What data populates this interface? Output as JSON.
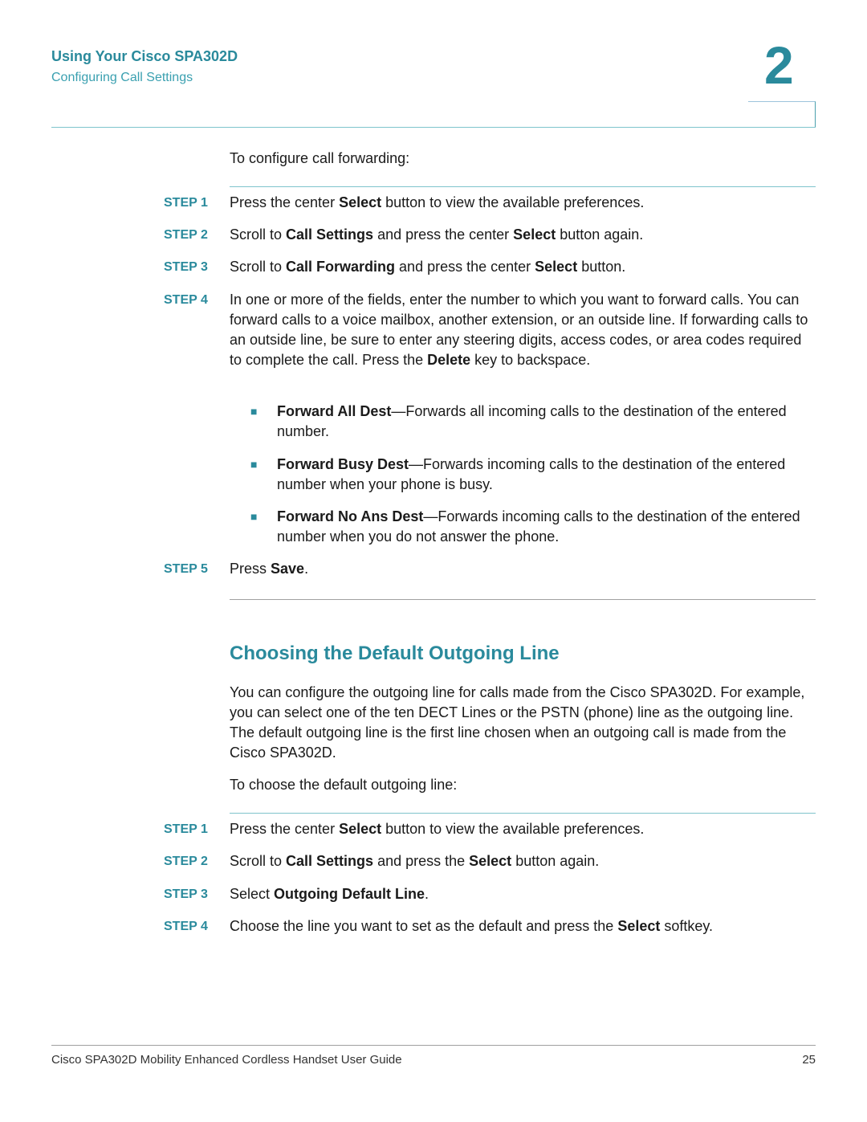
{
  "header": {
    "chapter_title": "Using Your Cisco SPA302D",
    "section": "Configuring Call Settings",
    "chapter_number": "2"
  },
  "forwarding": {
    "intro": "To configure call forwarding:",
    "steps": [
      {
        "label": "STEP 1",
        "parts": [
          "Press the center ",
          "Select",
          " button to view the available preferences."
        ]
      },
      {
        "label": "STEP 2",
        "parts": [
          "Scroll to ",
          "Call Settings",
          " and press the center ",
          "Select",
          " button again."
        ]
      },
      {
        "label": "STEP 3",
        "parts": [
          "Scroll to ",
          "Call Forwarding",
          " and press the center ",
          "Select",
          " button."
        ]
      },
      {
        "label": "STEP 4",
        "parts": [
          "In one or more of the fields, enter the number to which you want to forward calls. You can forward calls to a voice mailbox, another extension, or an outside line. If forwarding calls to an outside line, be sure to enter any steering digits, access codes, or area codes required to complete the call. Press the ",
          "Delete",
          " key to backspace."
        ]
      },
      {
        "label": "STEP 5",
        "parts": [
          "Press ",
          "Save",
          "."
        ]
      }
    ],
    "bullets": [
      {
        "term": "Forward All Dest",
        "desc": "—Forwards all incoming calls to the destination of the entered number."
      },
      {
        "term": "Forward Busy Dest",
        "desc": "—Forwards incoming calls to the destination of the entered number when your phone is busy."
      },
      {
        "term": "Forward No Ans Dest",
        "desc": "—Forwards incoming calls to the destination of the entered number when you do not answer the phone."
      }
    ]
  },
  "outgoing": {
    "title": "Choosing the Default Outgoing Line",
    "body": "You can configure the outgoing line for calls made from the Cisco SPA302D. For example, you can select one of the ten DECT Lines or the PSTN (phone) line as the outgoing line. The default outgoing line is the first line chosen when an outgoing call is made from the Cisco SPA302D.",
    "intro": "To choose the default outgoing line:",
    "steps": [
      {
        "label": "STEP 1",
        "parts": [
          "Press the center ",
          "Select",
          " button to view the available preferences."
        ]
      },
      {
        "label": "STEP 2",
        "parts": [
          "Scroll to ",
          "Call Settings",
          " and press the ",
          "Select",
          " button again."
        ]
      },
      {
        "label": "STEP 3",
        "parts": [
          "Select ",
          "Outgoing Default Line",
          "."
        ]
      },
      {
        "label": "STEP 4",
        "parts": [
          "Choose the line you want to set as the default and press the ",
          "Select",
          " softkey."
        ]
      }
    ]
  },
  "footer": {
    "guide_title": "Cisco SPA302D Mobility Enhanced Cordless Handset User Guide",
    "page_number": "25"
  }
}
